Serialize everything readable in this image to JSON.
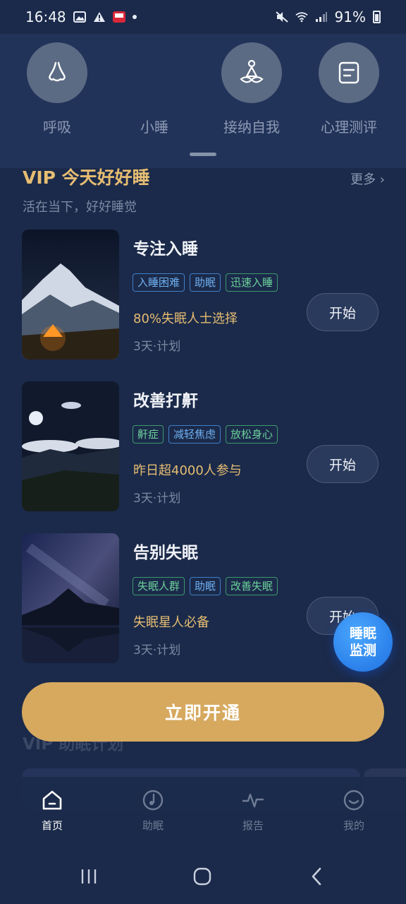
{
  "status_bar": {
    "time": "16:48",
    "battery": "91%",
    "icons": [
      "image-icon",
      "warning-icon",
      "app-notification-icon",
      "dot-icon",
      "mute-icon",
      "wifi-icon",
      "signal-icon",
      "battery-icon"
    ]
  },
  "quick_menu": {
    "items": [
      {
        "label": "呼吸",
        "icon": "nose-icon"
      },
      {
        "label": "小睡",
        "icon": "nap-icon"
      },
      {
        "label": "接纳自我",
        "icon": "meditation-icon"
      },
      {
        "label": "心理测评",
        "icon": "assessment-icon"
      }
    ]
  },
  "section": {
    "title": "VIP 今天好好睡",
    "subtitle": "活在当下，好好睡觉",
    "more": "更多"
  },
  "cards": [
    {
      "title": "专注入睡",
      "tags": [
        {
          "text": "入睡困难",
          "color": "blue"
        },
        {
          "text": "助眠",
          "color": "blue"
        },
        {
          "text": "迅速入睡",
          "color": "green"
        }
      ],
      "stat": "80%失眠人士选择",
      "plan": "3天·计划",
      "button": "开始"
    },
    {
      "title": "改善打鼾",
      "tags": [
        {
          "text": "鼾症",
          "color": "green"
        },
        {
          "text": "减轻焦虑",
          "color": "blue"
        },
        {
          "text": "放松身心",
          "color": "green"
        }
      ],
      "stat": "昨日超4000人参与",
      "plan": "3天·计划",
      "button": "开始"
    },
    {
      "title": "告别失眠",
      "tags": [
        {
          "text": "失眠人群",
          "color": "green"
        },
        {
          "text": "助眠",
          "color": "blue"
        },
        {
          "text": "改善失眠",
          "color": "green"
        }
      ],
      "stat": "失眠星人必备",
      "plan": "3天·计划",
      "button": "开始"
    }
  ],
  "fab": {
    "line1": "睡眠",
    "line2": "监测"
  },
  "behind_title": "VIP 助眠计划",
  "open_button": "立即开通",
  "tabs": [
    {
      "label": "首页",
      "icon": "home-icon",
      "active": true
    },
    {
      "label": "助眠",
      "icon": "music-note-icon",
      "active": false
    },
    {
      "label": "报告",
      "icon": "pulse-icon",
      "active": false
    },
    {
      "label": "我的",
      "icon": "smile-icon",
      "active": false
    }
  ],
  "colors": {
    "background": "#1b2a4a",
    "accent_gold": "#e6bd72",
    "button_gold": "#d6a95f",
    "fab_blue": "#1e6fe0"
  }
}
